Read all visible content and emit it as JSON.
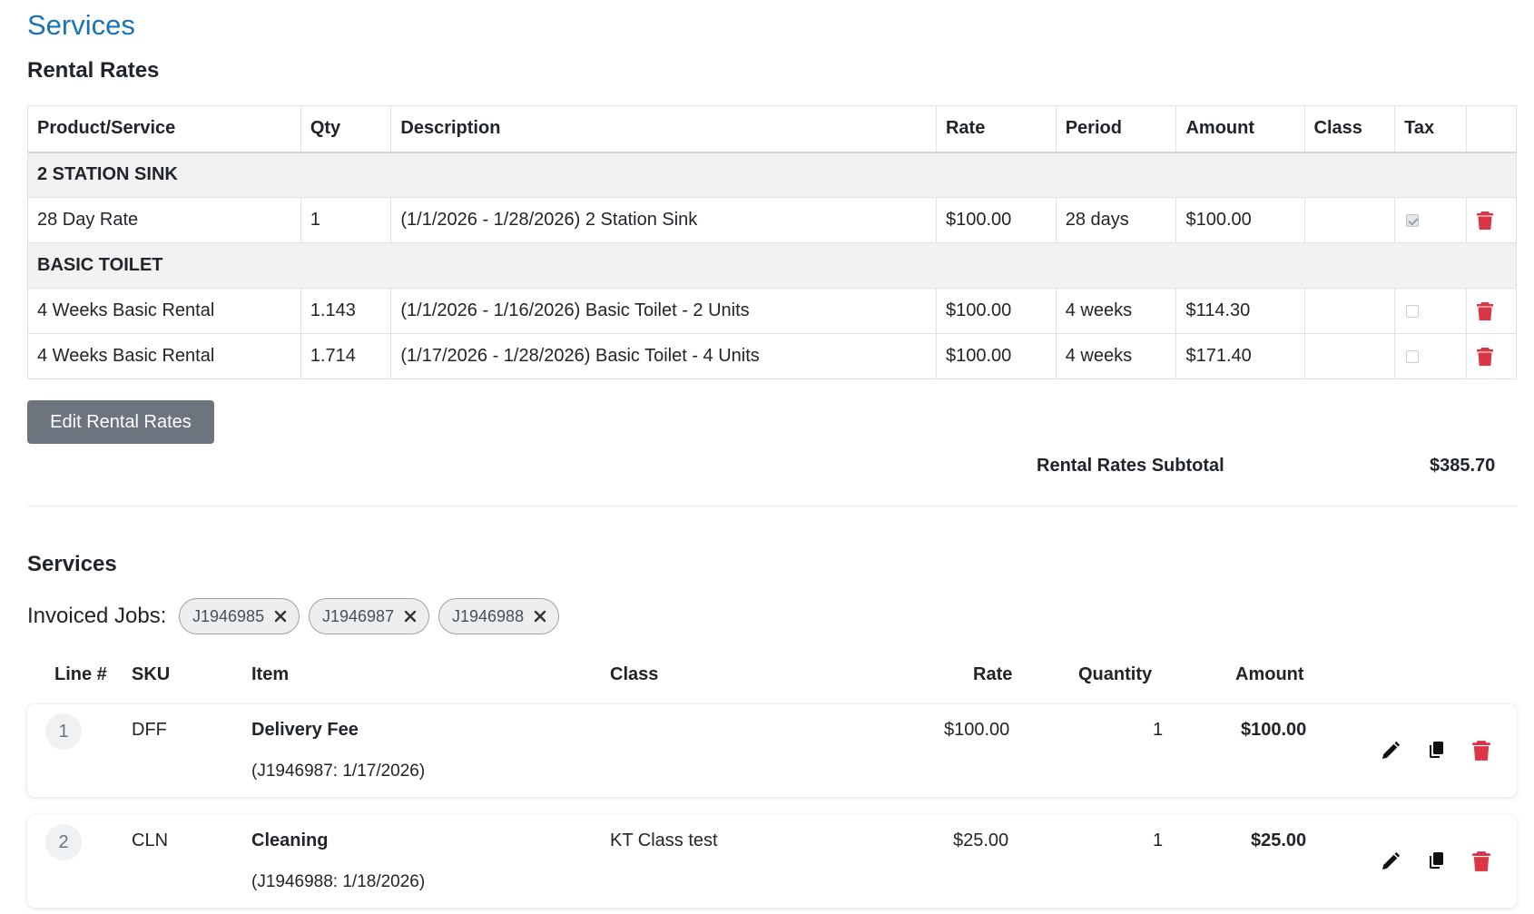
{
  "page_title": "Services",
  "rental": {
    "title": "Rental Rates",
    "headers": [
      "Product/Service",
      "Qty",
      "Description",
      "Rate",
      "Period",
      "Amount",
      "Class",
      "Tax",
      ""
    ],
    "groups": [
      {
        "name": "2 STATION SINK",
        "rows": [
          {
            "product": "28 Day Rate",
            "qty": "1",
            "description": "(1/1/2026 - 1/28/2026) 2 Station Sink",
            "rate": "$100.00",
            "period": "28 days",
            "amount": "$100.00",
            "class": "",
            "tax": true
          }
        ]
      },
      {
        "name": "BASIC TOILET",
        "rows": [
          {
            "product": "4 Weeks Basic Rental",
            "qty": "1.143",
            "description": "(1/1/2026 - 1/16/2026) Basic Toilet - 2 Units",
            "rate": "$100.00",
            "period": "4 weeks",
            "amount": "$114.30",
            "class": "",
            "tax": false
          },
          {
            "product": "4 Weeks Basic Rental",
            "qty": "1.714",
            "description": "(1/17/2026 - 1/28/2026) Basic Toilet - 4 Units",
            "rate": "$100.00",
            "period": "4 weeks",
            "amount": "$171.40",
            "class": "",
            "tax": false
          }
        ]
      }
    ],
    "edit_button": "Edit Rental Rates",
    "subtotal_label": "Rental Rates Subtotal",
    "subtotal_value": "$385.70"
  },
  "services": {
    "title": "Services",
    "invoiced_jobs_label": "Invoiced Jobs:",
    "jobs": [
      "J1946985",
      "J1946987",
      "J1946988"
    ],
    "headers": {
      "line": "Line #",
      "sku": "SKU",
      "item": "Item",
      "class": "Class",
      "rate": "Rate",
      "quantity": "Quantity",
      "amount": "Amount"
    },
    "lines": [
      {
        "line": "1",
        "sku": "DFF",
        "item": "Delivery Fee",
        "note": "(J1946987: 1/17/2026)",
        "class": "",
        "rate": "$100.00",
        "quantity": "1",
        "amount": "$100.00"
      },
      {
        "line": "2",
        "sku": "CLN",
        "item": "Cleaning",
        "note": "(J1946988: 1/18/2026)",
        "class": "KT Class test",
        "rate": "$25.00",
        "quantity": "1",
        "amount": "$25.00"
      }
    ]
  },
  "icons": {
    "delete": "trash-icon",
    "edit": "pencil-icon",
    "copy": "copy-icon",
    "remove_chip": "close-icon"
  },
  "colors": {
    "accent": "#1a73b5",
    "danger": "#dc3545",
    "button": "#6c757d"
  }
}
